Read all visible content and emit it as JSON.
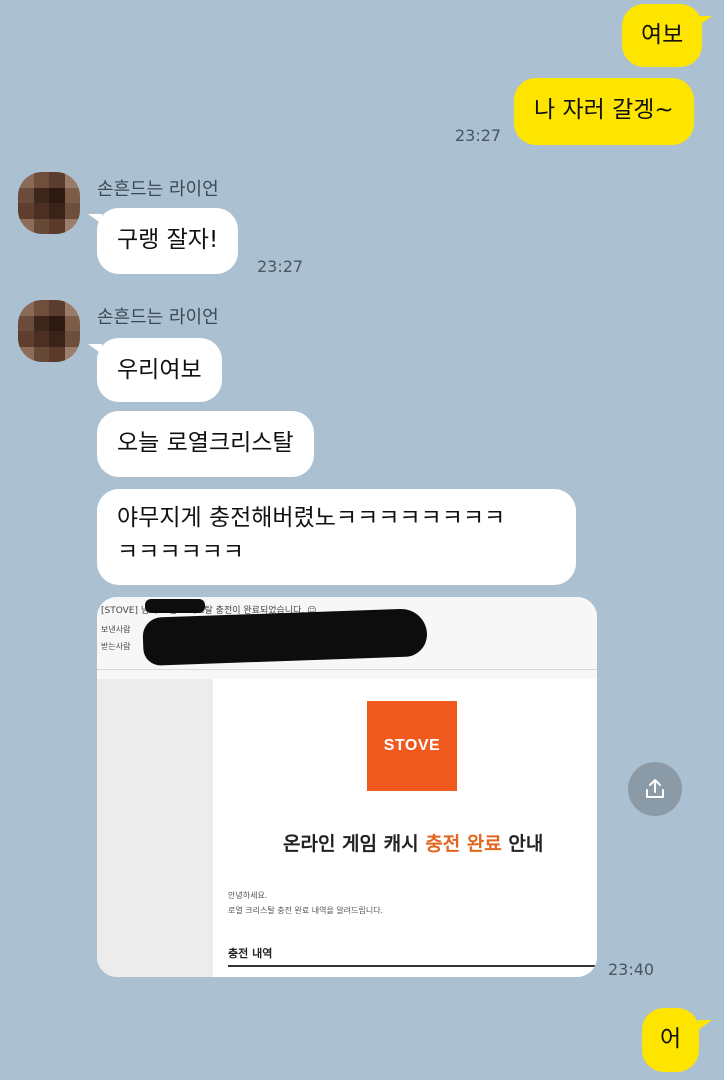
{
  "messages": {
    "m1": "여보",
    "m2": "나 자러 갈겡~",
    "m2_time": "23:27",
    "sender1": "손흔드는 라이언",
    "m3": "구랭 잘자!",
    "m3_time": "23:27",
    "sender2": "손흔드는 라이언",
    "m4": "우리여보",
    "m5": "오늘 로열크리스탈",
    "m6_line1": "야무지게 충전해버렸노ㅋㅋㅋㅋㅋㅋㅋㅋ",
    "m6_line2": "ㅋㅋㅋㅋㅋㅋ",
    "image_time": "23:40",
    "m7": "어"
  },
  "email": {
    "subject": "[STOVE]         님의 로열 크리스탈 충전이 완료되었습니다. ☺",
    "from_label": "보낸사람",
    "to_label": "받는사람",
    "logo_text": "STOVE",
    "title_prefix": "온라인 게임 캐시 ",
    "title_accent": "충전 완료",
    "title_suffix": " 안내",
    "greeting": "안녕하세요.",
    "description": "로열 크리스탈 충전 완료 내역을 알려드립니다.",
    "section_label": "충전 내역"
  },
  "colors": {
    "chat_background": "#abc1d1",
    "my_bubble": "#fee500",
    "other_bubble": "#ffffff",
    "stove_orange": "#f05a1f",
    "title_accent": "#e2661f"
  },
  "icons": {
    "share": "share-icon"
  }
}
